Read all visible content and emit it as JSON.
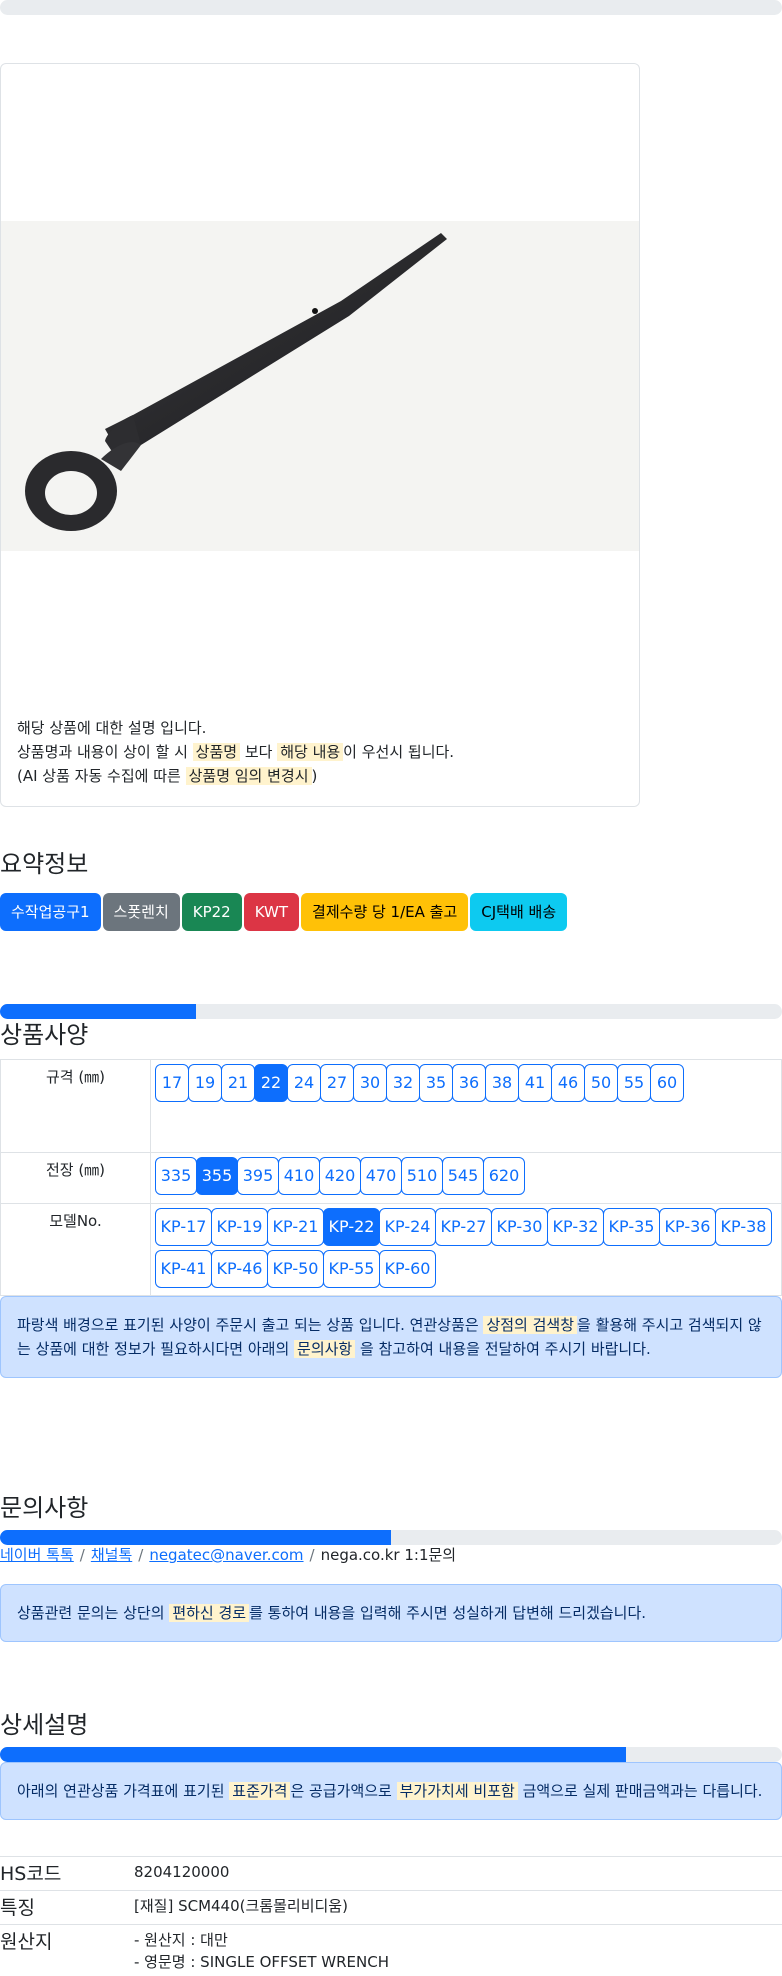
{
  "colors": {
    "primary": "#0d6efd",
    "secondary": "#6c757d",
    "success": "#198754",
    "danger": "#dc3545",
    "warning": "#ffc107",
    "info": "#0dcaf0",
    "highlight": "#fff3cd",
    "alert_bg": "#cfe2ff"
  },
  "top_progress": {
    "value": 0
  },
  "product": {
    "image_icon": "offset-wrench-image",
    "desc_line1": "해당 상품에 대한 설명 입니다.",
    "desc_line2_pre": "상품명과 내용이 상이 할 시 ",
    "desc_line2_mark1": "상품명",
    "desc_line2_mid": " 보다 ",
    "desc_line2_mark2": "해당 내용",
    "desc_line2_post": "이 우선시 됩니다.",
    "desc_line3_pre": "(AI 상품 자동 수집에 따른 ",
    "desc_line3_mark": "상품명 임의 변경시",
    "desc_line3_post": ")"
  },
  "summary": {
    "title": "요약정보",
    "badges": [
      "수작업공구1",
      "스폿렌치",
      "KP22",
      "KWT",
      "결제수량 당 1/EA 출고",
      "CJ택배 배송"
    ]
  },
  "spec": {
    "title": "상품사양",
    "progress": 0.25,
    "rows": [
      {
        "label": "규격 (㎜)",
        "options": [
          "17",
          "19",
          "21",
          "22",
          "24",
          "27",
          "30",
          "32",
          "35",
          "36",
          "38",
          "41",
          "46",
          "50",
          "55",
          "60"
        ],
        "selected": "22"
      },
      {
        "label": "전장 (㎜)",
        "options": [
          "335",
          "355",
          "395",
          "410",
          "420",
          "470",
          "510",
          "545",
          "620"
        ],
        "selected": "355"
      },
      {
        "label": "모델No.",
        "options": [
          "KP-17",
          "KP-19",
          "KP-21",
          "KP-22",
          "KP-24",
          "KP-27",
          "KP-30",
          "KP-32",
          "KP-35",
          "KP-36",
          "KP-38",
          "KP-41",
          "KP-46",
          "KP-50",
          "KP-55",
          "KP-60"
        ],
        "selected": "KP-22"
      }
    ],
    "notice_pre": "파랑색 배경으로 표기된 사양이 주문시 출고 되는 상품 입니다. 연관상품은 ",
    "notice_mark1": "상점의 검색창",
    "notice_mid": "을 활용해 주시고 검색되지 않는 상품에 대한 정보가 필요하시다면 아래의 ",
    "notice_mark2": "문의사항",
    "notice_post": " 을 참고하여 내용을 전달하여 주시기 바랍니다."
  },
  "inquiry": {
    "title": "문의사항",
    "progress": 0.5,
    "links": [
      "네이버 톡톡",
      "채널톡",
      "negatec@naver.com"
    ],
    "plain": "nega.co.kr 1:1문의",
    "notice_pre": "상품관련 문의는 상단의 ",
    "notice_mark": "편하신 경로",
    "notice_post": "를 통하여 내용을 입력해 주시면 성실하게 답변해 드리겠습니다."
  },
  "detail": {
    "title": "상세설명",
    "progress": 0.8,
    "notice_pre": "아래의 연관상품 가격표에 표기된 ",
    "notice_mark1": "표준가격",
    "notice_mid": "은 공급가액으로 ",
    "notice_mark2": "부가가치세 비포함",
    "notice_post": " 금액으로 실제 판매금액과는 다릅니다.",
    "rows": [
      {
        "key": "HS코드",
        "lines": [
          "8204120000"
        ]
      },
      {
        "key": "특징",
        "lines": [
          "[재질] SCM440(크롬몰리비디움)"
        ]
      },
      {
        "key": "원산지",
        "lines": [
          "- 원산지 : 대만",
          "- 영문명 : SINGLE OFFSET WRENCH"
        ]
      }
    ]
  }
}
